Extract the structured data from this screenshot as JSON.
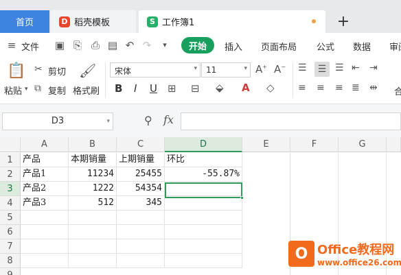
{
  "tabs": {
    "home": "首页",
    "template": "稻壳模板",
    "template_icon": "D",
    "document": "工作簿1",
    "document_icon": "S",
    "add": "+"
  },
  "menu": {
    "file": "文件",
    "start": "开始",
    "insert": "插入",
    "page_layout": "页面布局",
    "formula": "公式",
    "data": "数据",
    "review_partial": "审阅"
  },
  "ribbon": {
    "paste": "粘贴",
    "cut": "剪切",
    "copy": "复制",
    "format_painter": "格式刷",
    "font_name": "宋体",
    "font_size": "11",
    "bold": "B",
    "italic": "I",
    "underline": "U",
    "merge_partial": "合"
  },
  "formula_bar": {
    "name_box": "D3",
    "fx": "fx",
    "value": ""
  },
  "sheet": {
    "columns": [
      "A",
      "B",
      "C",
      "D",
      "E",
      "F",
      "G"
    ],
    "rows": [
      "1",
      "2",
      "3",
      "4",
      "5",
      "6",
      "7",
      "8",
      "9"
    ],
    "active_col": "D",
    "active_row": "3",
    "cells": [
      [
        "产品",
        "本期销量",
        "上期销量",
        "环比"
      ],
      [
        "产品1",
        "11234",
        "25455",
        "-55.87%"
      ],
      [
        "产品2",
        "1222",
        "54354",
        ""
      ],
      [
        "产品3",
        "512",
        "345",
        ""
      ]
    ]
  },
  "watermark": {
    "logo": "O",
    "title": "Office教程网",
    "url": "www.office26.com"
  },
  "colors": {
    "accent_green": "#17a05d",
    "home_tab_blue": "#3f83e0",
    "selection_green": "#2f9a5a",
    "watermark_orange": "#f26a1b"
  }
}
